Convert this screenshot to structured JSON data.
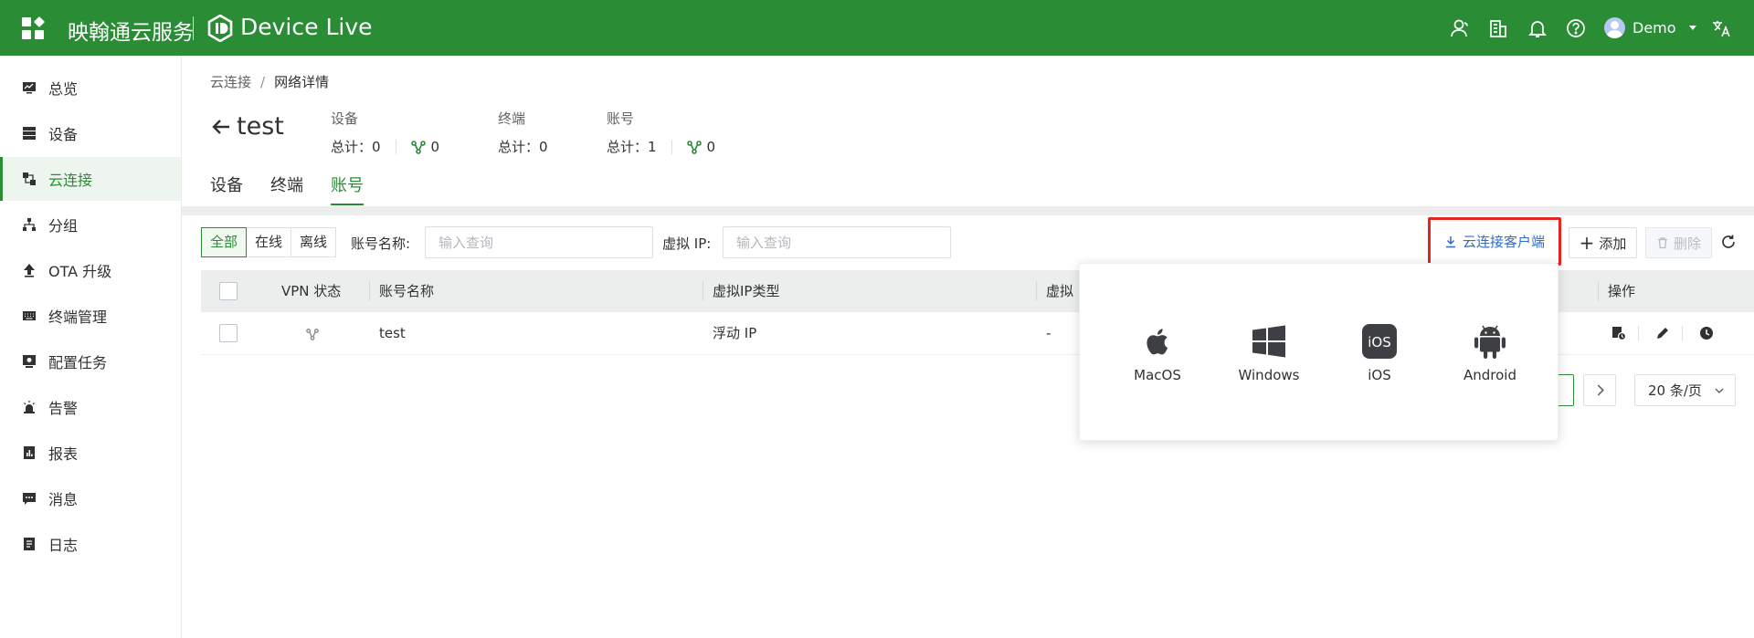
{
  "topbar": {
    "brand_cn": "映翰通云服务",
    "brand_en": "Device Live",
    "user_name": "Demo",
    "icons": [
      "apps-icon",
      "user-icon",
      "building-icon",
      "bell-icon",
      "help-icon",
      "translate-icon"
    ]
  },
  "sidebar": {
    "items": [
      {
        "label": "总览",
        "icon": "monitor-icon"
      },
      {
        "label": "设备",
        "icon": "server-icon"
      },
      {
        "label": "云连接",
        "icon": "cloud-connect-icon",
        "active": true
      },
      {
        "label": "分组",
        "icon": "tree-icon"
      },
      {
        "label": "OTA 升级",
        "icon": "upload-icon"
      },
      {
        "label": "终端管理",
        "icon": "keyboard-icon"
      },
      {
        "label": "配置任务",
        "icon": "task-icon"
      },
      {
        "label": "告警",
        "icon": "siren-icon"
      },
      {
        "label": "报表",
        "icon": "report-icon"
      },
      {
        "label": "消息",
        "icon": "message-icon"
      },
      {
        "label": "日志",
        "icon": "log-icon"
      }
    ]
  },
  "breadcrumb": {
    "parent": "云连接",
    "separator": "/",
    "current": "网络详情"
  },
  "page": {
    "title": "test",
    "stats": [
      {
        "label": "设备",
        "total_label": "总计：0",
        "online": "0"
      },
      {
        "label": "终端",
        "total_label": "总计：0"
      },
      {
        "label": "账号",
        "total_label": "总计：1",
        "online": "0"
      }
    ],
    "tabs": [
      "设备",
      "终端",
      "账号"
    ],
    "active_tab": "账号"
  },
  "filters": {
    "segments": [
      "全部",
      "在线",
      "离线"
    ],
    "active_segment": "全部",
    "account_label": "账号名称:",
    "account_placeholder": "输入查询",
    "ip_label": "虚拟 IP:",
    "ip_placeholder": "输入查询"
  },
  "actions": {
    "download_client": "云连接客户端",
    "add": "添加",
    "delete": "删除"
  },
  "table": {
    "columns": [
      "VPN 状态",
      "账号名称",
      "虚拟IP类型",
      "虚拟",
      "操作"
    ],
    "rows": [
      {
        "vpn_status": "network-icon",
        "name": "test",
        "ip_type": "浮动 IP",
        "virtual": "-"
      }
    ]
  },
  "pagination": {
    "page_size": "20 条/页"
  },
  "popover": {
    "items": [
      {
        "label": "MacOS",
        "icon": "apple-icon"
      },
      {
        "label": "Windows",
        "icon": "windows-icon"
      },
      {
        "label": "iOS",
        "icon": "ios-icon",
        "glyph": "iOS"
      },
      {
        "label": "Android",
        "icon": "android-icon"
      }
    ]
  },
  "colors": {
    "brand_green": "#2b8c36",
    "link_blue": "#2f6bd1",
    "highlight_red": "#e52520"
  }
}
